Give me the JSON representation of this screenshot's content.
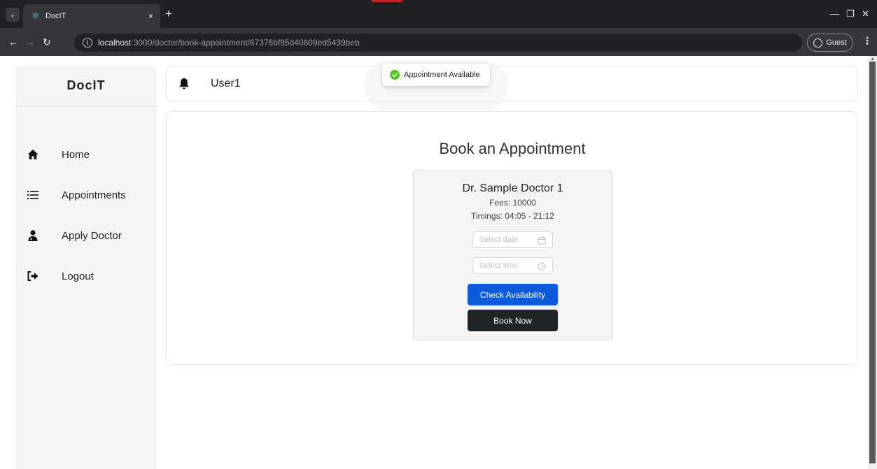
{
  "browser": {
    "tab_title": "DocIT",
    "tab_close": "×",
    "new_tab": "+",
    "url_host": "localhost",
    "url_path": ":3000/doctor/book-appointment/67376bf95d40609ed5439beb",
    "profile_label": "Guest"
  },
  "sidebar": {
    "logo": "DocIT",
    "items": [
      {
        "label": "Home",
        "icon": "home-icon"
      },
      {
        "label": "Appointments",
        "icon": "list-icon"
      },
      {
        "label": "Apply Doctor",
        "icon": "user-doctor-icon"
      },
      {
        "label": "Logout",
        "icon": "logout-icon"
      }
    ]
  },
  "header": {
    "user_name": "User1"
  },
  "toast": {
    "message": "Appointment Available",
    "color": "#52c41a"
  },
  "main": {
    "title": "Book an Appointment",
    "doctor": {
      "name": "Dr. Sample Doctor 1",
      "fees": "Fees: 10000",
      "timings": "Timings: 04:05 - 21:12"
    },
    "date_placeholder": "Select date",
    "time_placeholder": "Select time",
    "check_label": "Check Availability",
    "book_label": "Book Now",
    "colors": {
      "check_button": "#0d5bdb",
      "book_button": "#1f2428"
    }
  }
}
